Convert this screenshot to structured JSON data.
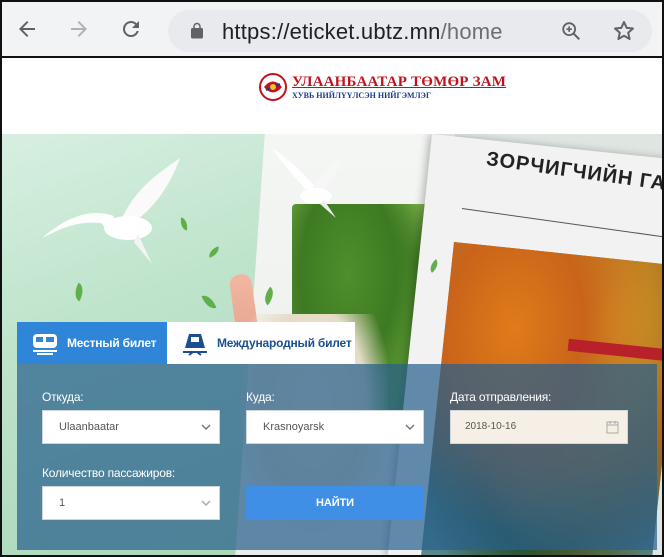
{
  "browser": {
    "url_host": "https://eticket.ubtz.mn",
    "url_path": "/home"
  },
  "site": {
    "logo_main": "УЛААНБААТАР ТӨМӨР ЗАМ",
    "logo_sub": "ХУВЬ НИЙЛҮҮЛСЭН НИЙГЭМЛЭГ"
  },
  "hero": {
    "paper_title": "ЗОРЧИГЧИЙН ГАЛТ"
  },
  "tabs": [
    {
      "label": "Местный билет",
      "active": true
    },
    {
      "label": "Международный билет",
      "active": false
    }
  ],
  "form": {
    "from_label": "Откуда:",
    "from_value": "Ulaanbaatar",
    "to_label": "Куда:",
    "to_value": "Krasnoyarsk",
    "date_label": "Дата отправления:",
    "date_value": "2018-10-16",
    "passengers_label": "Количество пассажиров:",
    "passengers_value": "1",
    "search_button": "НАЙТИ"
  },
  "colors": {
    "tab_active": "#2f86d8",
    "panel": "#28608c",
    "button": "#3f8fe6",
    "logo_red": "#c1121f",
    "logo_blue": "#1d3a8a"
  },
  "icons": [
    "back-arrow-icon",
    "forward-arrow-icon",
    "reload-icon",
    "lock-icon",
    "zoom-icon",
    "star-icon",
    "train-icon",
    "caret-down-icon",
    "calendar-icon"
  ]
}
